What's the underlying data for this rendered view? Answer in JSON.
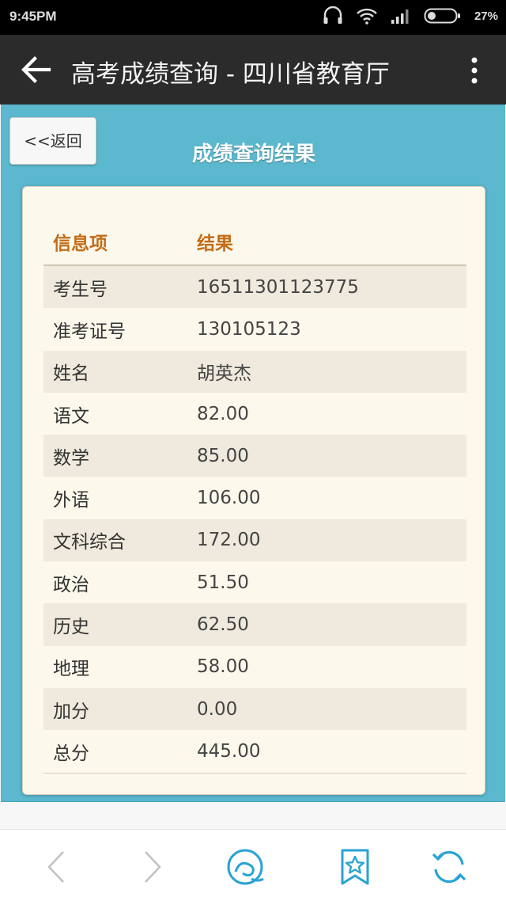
{
  "status_bar": {
    "time": "9:45PM",
    "battery_percent": "27%",
    "icons": [
      "headset-icon",
      "wifi-icon",
      "signal-icon",
      "battery-icon"
    ]
  },
  "app_bar": {
    "title": "高考成绩查询 - 四川省教育厅",
    "back_icon": "arrow-left-icon",
    "menu_icon": "overflow-menu-icon"
  },
  "page": {
    "back_button": "<<返回",
    "heading": "成绩查询结果",
    "table": {
      "headers": [
        "信息项",
        "结果"
      ],
      "rows": [
        {
          "label": "考生号",
          "value": "16511301123775"
        },
        {
          "label": "准考证号",
          "value": "130105123"
        },
        {
          "label": "姓名",
          "value": "胡英杰"
        },
        {
          "label": "语文",
          "value": "82.00"
        },
        {
          "label": "数学",
          "value": "85.00"
        },
        {
          "label": "外语",
          "value": "106.00"
        },
        {
          "label": "文科综合",
          "value": "172.00"
        },
        {
          "label": "政治",
          "value": "51.50"
        },
        {
          "label": "历史",
          "value": "62.50"
        },
        {
          "label": "地理",
          "value": "58.00"
        },
        {
          "label": "加分",
          "value": "0.00"
        },
        {
          "label": "总分",
          "value": "445.00"
        }
      ]
    }
  },
  "bottom_bar": {
    "icons": [
      "back-nav-icon",
      "forward-nav-icon",
      "home-icon",
      "bookmark-icon",
      "refresh-icon"
    ]
  },
  "colors": {
    "panel": "#5bb8cf",
    "card": "#fcf8ec",
    "header_text": "#c26d18",
    "accent_icons": "#29a3d3"
  }
}
